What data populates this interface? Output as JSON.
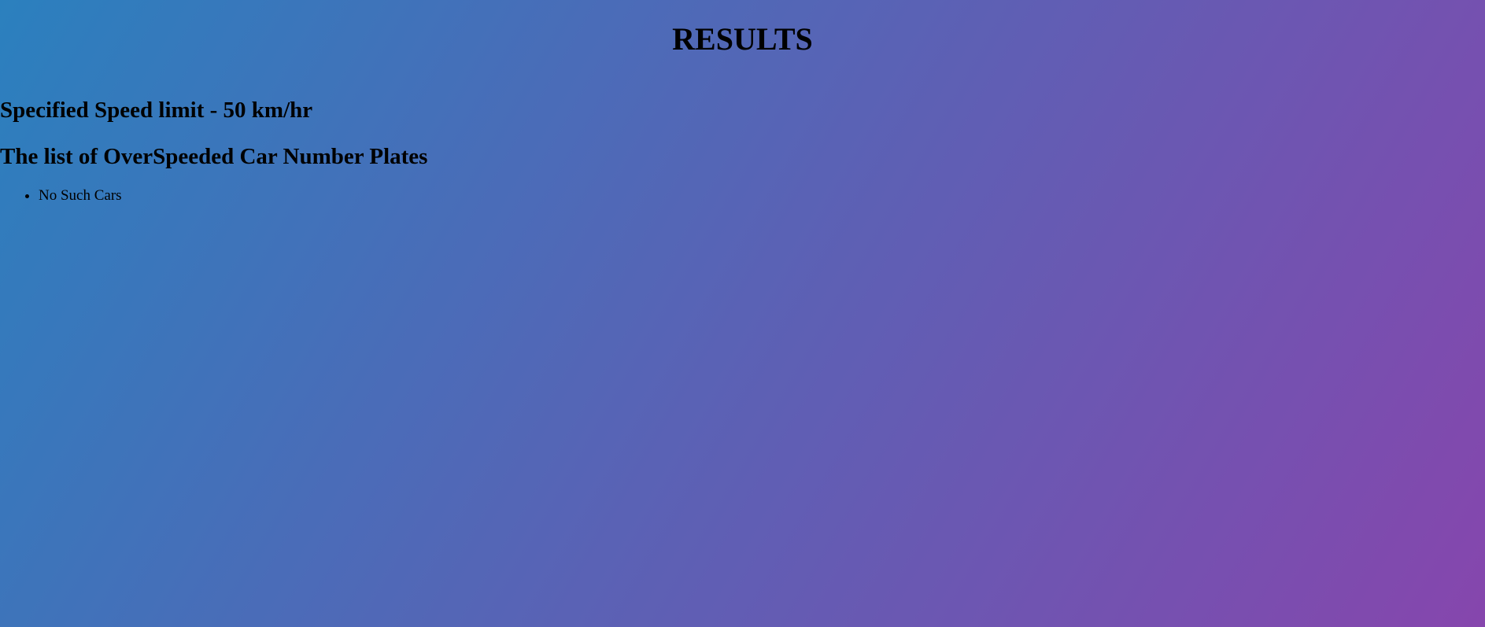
{
  "page": {
    "title": "RESULTS",
    "speed_limit_heading": "Specified Speed limit - 50 km/hr",
    "list_heading": "The list of OverSpeeded Car Number Plates",
    "cars": [
      "No Such Cars"
    ]
  },
  "colors": {
    "gradient_start": "#2b80be",
    "gradient_mid": "#5a62b5",
    "gradient_end": "#8646ad",
    "text": "#000000"
  }
}
